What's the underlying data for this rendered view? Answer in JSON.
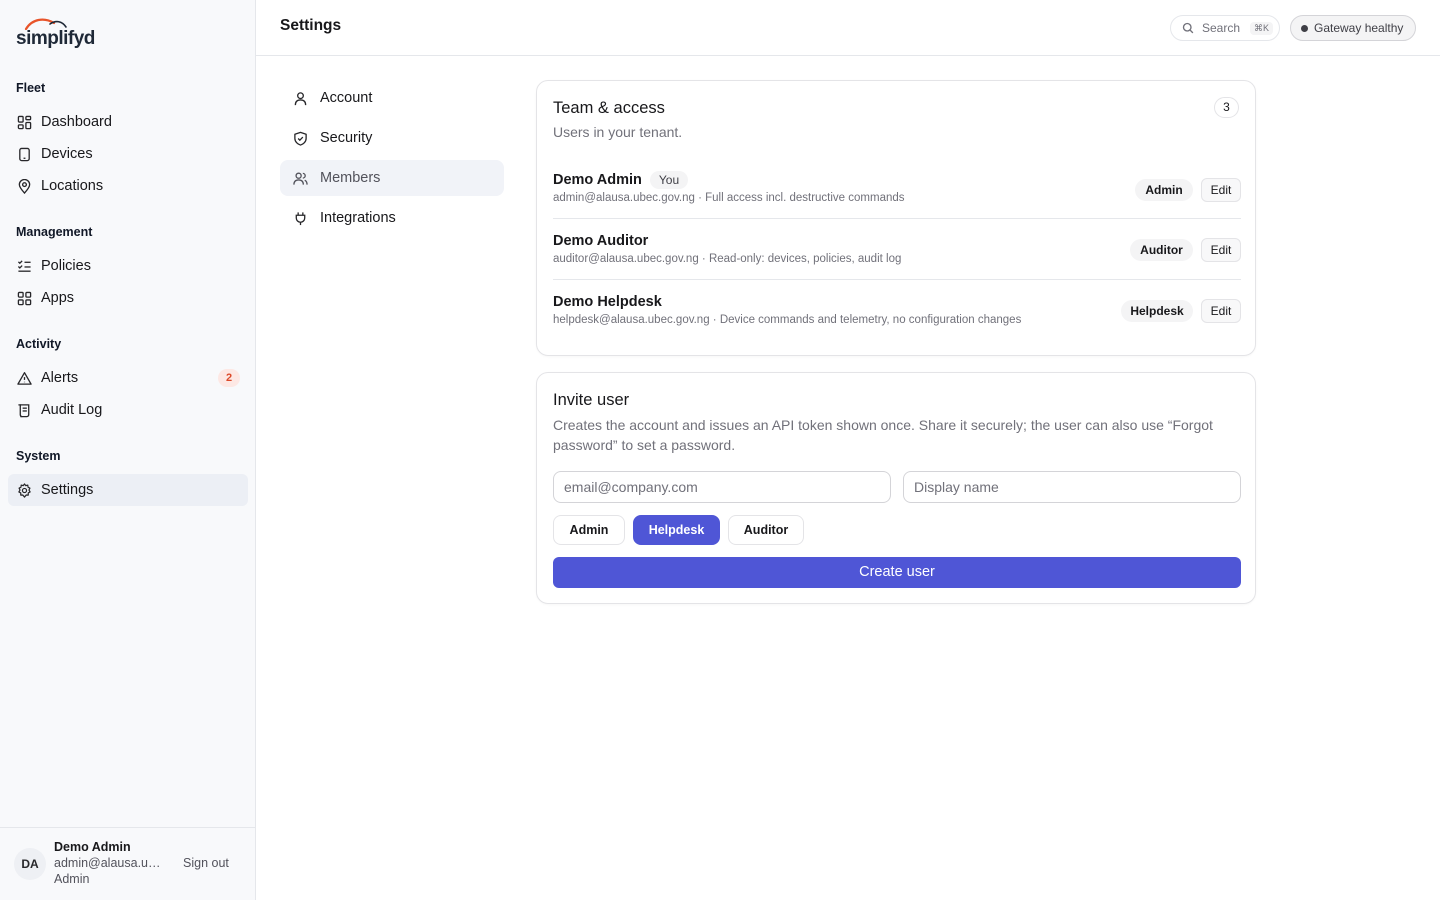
{
  "app": {
    "logo_text": "simplifyd",
    "header_title": "Settings",
    "search_label": "Search",
    "search_shortcut": "⌘K",
    "gateway_status": "Gateway healthy"
  },
  "sidebar": {
    "groups": [
      {
        "title": "Fleet",
        "items": [
          {
            "label": "Dashboard",
            "icon": "grid-icon"
          },
          {
            "label": "Devices",
            "icon": "device-icon"
          },
          {
            "label": "Locations",
            "icon": "map-pin-icon"
          }
        ]
      },
      {
        "title": "Management",
        "items": [
          {
            "label": "Policies",
            "icon": "list-check-icon"
          },
          {
            "label": "Apps",
            "icon": "apps-grid-icon"
          }
        ]
      },
      {
        "title": "Activity",
        "items": [
          {
            "label": "Alerts",
            "icon": "warning-triangle-icon",
            "badge": "2"
          },
          {
            "label": "Audit Log",
            "icon": "scroll-icon"
          }
        ]
      },
      {
        "title": "System",
        "items": [
          {
            "label": "Settings",
            "icon": "gear-icon",
            "active": true
          }
        ]
      }
    ],
    "user": {
      "initials": "DA",
      "name": "Demo Admin",
      "email": "admin@alausa.ubec.gov.ng",
      "role": "Admin",
      "sign_out": "Sign out"
    }
  },
  "settings_nav": {
    "items": [
      {
        "label": "Account",
        "icon": "user-icon"
      },
      {
        "label": "Security",
        "icon": "shield-check-icon"
      },
      {
        "label": "Members",
        "icon": "users-icon",
        "active": true
      },
      {
        "label": "Integrations",
        "icon": "plug-icon"
      }
    ]
  },
  "team": {
    "title": "Team & access",
    "subtitle": "Users in your tenant.",
    "count": "3",
    "members": [
      {
        "name": "Demo Admin",
        "tag": "You",
        "detail": "admin@alausa.ubec.gov.ng · Full access incl. destructive commands",
        "role": "Admin",
        "edit": "Edit"
      },
      {
        "name": "Demo Auditor",
        "detail": "auditor@alausa.ubec.gov.ng · Read-only: devices, policies, audit log",
        "role": "Auditor",
        "edit": "Edit"
      },
      {
        "name": "Demo Helpdesk",
        "detail": "helpdesk@alausa.ubec.gov.ng · Device commands and telemetry, no configuration changes",
        "role": "Helpdesk",
        "edit": "Edit"
      }
    ]
  },
  "invite": {
    "title": "Invite user",
    "description": "Creates the account and issues an API token shown once. Share it securely; the user can also use “Forgot password” to set a password.",
    "email_placeholder": "email@company.com",
    "name_placeholder": "Display name",
    "roles": [
      "Admin",
      "Helpdesk",
      "Auditor"
    ],
    "selected_role": "Helpdesk",
    "submit": "Create user"
  },
  "colors": {
    "accent": "#4f56d6",
    "alert_badge_bg": "#fde8e4",
    "alert_badge_text": "#dc4a2a",
    "logo_arc": "#e8542a"
  }
}
